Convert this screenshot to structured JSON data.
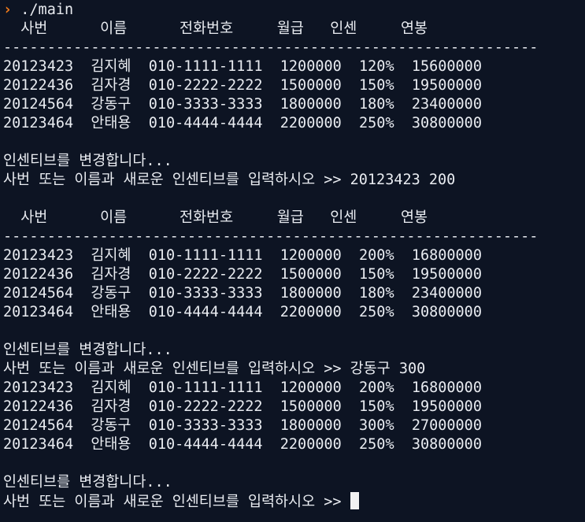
{
  "colors": {
    "background": "#0d1423",
    "foreground": "#e9ecf1",
    "prompt_symbol": "#f07a1a",
    "cursor": "#f2f2f2"
  },
  "prompt": {
    "symbol": "›",
    "command": " ./main"
  },
  "lines": [
    "  사번      이름      전화번호     월급   인센     연봉",
    "-------------------------------------------------------------",
    "20123423  김지혜  010-1111-1111  1200000  120%  15600000",
    "20122436  김자경  010-2222-2222  1500000  150%  19500000",
    "20124564  강동구  010-3333-3333  1800000  180%  23400000",
    "20123464  안태용  010-4444-4444  2200000  250%  30800000",
    "",
    "인센티브를 변경합니다...",
    "사번 또는 이름과 새로운 인센티브를 입력하시오 >> 20123423 200",
    "",
    "  사번      이름      전화번호     월급   인센     연봉",
    "-------------------------------------------------------------",
    "20123423  김지혜  010-1111-1111  1200000  200%  16800000",
    "20122436  김자경  010-2222-2222  1500000  150%  19500000",
    "20124564  강동구  010-3333-3333  1800000  180%  23400000",
    "20123464  안태용  010-4444-4444  2200000  250%  30800000",
    "",
    "인센티브를 변경합니다...",
    "사번 또는 이름과 새로운 인센티브를 입력하시오 >> 강동구 300",
    "20123423  김지혜  010-1111-1111  1200000  200%  16800000",
    "20122436  김자경  010-2222-2222  1500000  150%  19500000",
    "20124564  강동구  010-3333-3333  1800000  300%  27000000",
    "20123464  안태용  010-4444-4444  2200000  250%  30800000",
    "",
    "인센티브를 변경합니다..."
  ],
  "input_line": {
    "text": "사번 또는 이름과 새로운 인센티브를 입력하시오 >> "
  }
}
